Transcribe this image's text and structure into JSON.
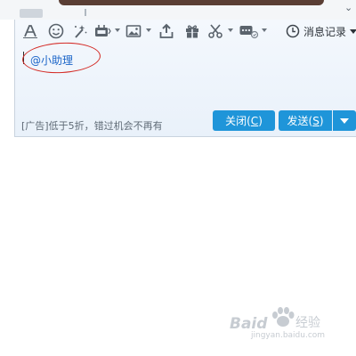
{
  "toolbar": {
    "icons": [
      "font-icon",
      "emoji-icon",
      "magic-icon",
      "screen-shake-icon",
      "image-icon",
      "upload-file-icon",
      "gift-icon",
      "screenshot-icon",
      "more-icon"
    ],
    "history_label": "消息记录"
  },
  "input": {
    "mention_text": "@小助理"
  },
  "footer": {
    "ad_text": "[广告]低于5折，错过机会不再有",
    "close_label": "关闭(",
    "close_key": "C",
    "send_label": "发送(",
    "send_key": "S",
    "label_suffix": ")"
  },
  "watermark": {
    "brand_left": "Baid",
    "brand_right": "经验",
    "url": "jingyan.baidu.com"
  },
  "colors": {
    "button_blue": "#1f95d9",
    "annotation_red": "#d42a25",
    "mention_blue": "#1a64c8"
  }
}
